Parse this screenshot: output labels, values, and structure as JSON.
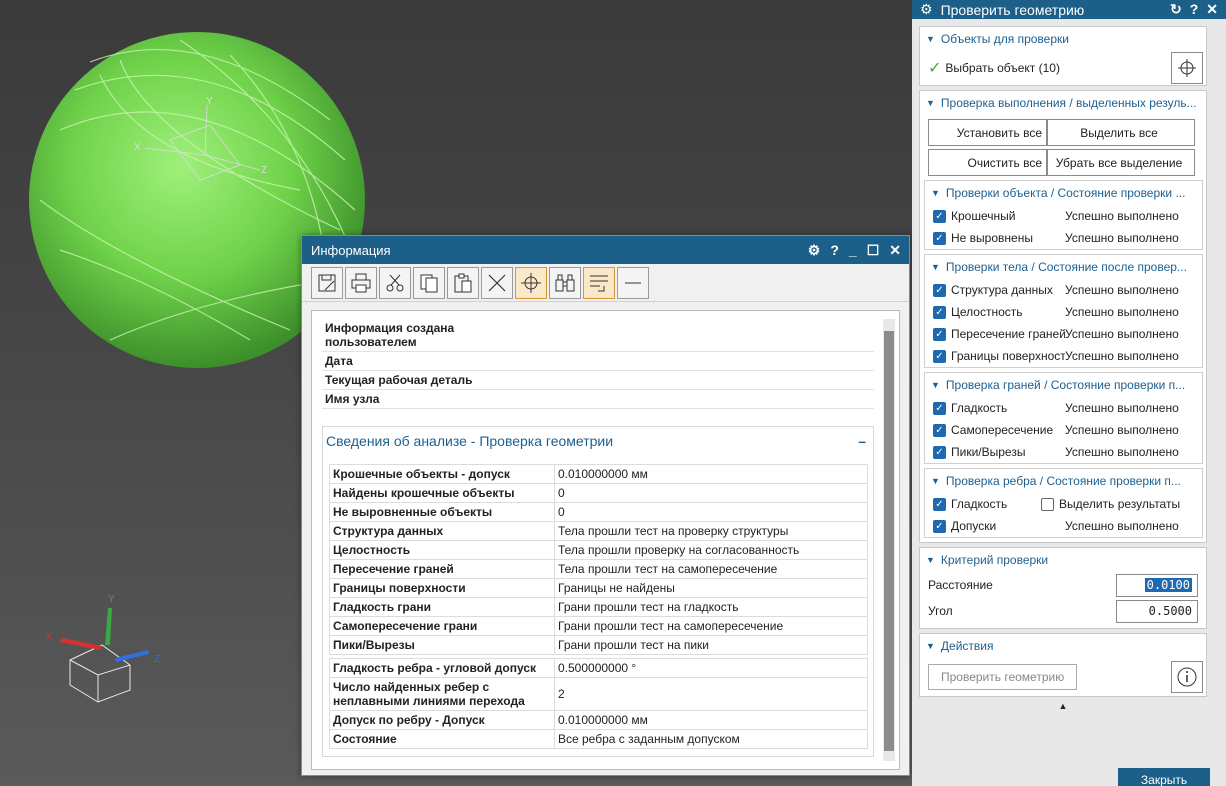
{
  "viewport": {
    "axis_x": "X",
    "axis_y": "Y",
    "axis_z": "Z"
  },
  "info": {
    "title": "Информация",
    "toolbar_icons": [
      "save-icon",
      "print-icon",
      "cut-icon",
      "copy-icon",
      "paste-icon",
      "delete-icon",
      "target-icon",
      "binoculars-icon",
      "wrap-icon",
      "minus-icon"
    ],
    "meta": [
      {
        "key": "Информация создана пользователем",
        "value": ""
      },
      {
        "key": "Дата",
        "value": ""
      },
      {
        "key": "Текущая рабочая деталь",
        "value": ""
      },
      {
        "key": "Имя узла",
        "value": ""
      }
    ],
    "section_title": "Сведения об анализе - Проверка геометрии",
    "section_collapse": "–",
    "rows1": [
      {
        "k": "Крошечные объекты - допуск",
        "v": "0.010000000 мм"
      },
      {
        "k": "Найдены крошечные объекты",
        "v": "0"
      },
      {
        "k": "Не выровненные объекты",
        "v": "0"
      },
      {
        "k": "Структура данных",
        "v": "Тела прошли тест на проверку структуры"
      },
      {
        "k": "Целостность",
        "v": "Тела прошли проверку на согласованность"
      },
      {
        "k": "Пересечение граней",
        "v": "Тела прошли тест на самопересечение"
      },
      {
        "k": "Границы поверхности",
        "v": "Границы не найдены"
      },
      {
        "k": "Гладкость грани",
        "v": "Грани прошли тест на гладкость"
      },
      {
        "k": "Самопересечение грани",
        "v": "Грани прошли тест на самопересечение"
      },
      {
        "k": "Пики/Вырезы",
        "v": "Грани прошли тест на пики"
      }
    ],
    "rows2": [
      {
        "k": "Гладкость ребра - угловой допуск",
        "v": "0.500000000 °"
      },
      {
        "k": "Число найденных ребер с неплавными линиями перехода",
        "v": "2"
      },
      {
        "k": "Допуск по ребру - Допуск",
        "v": "0.010000000 мм"
      },
      {
        "k": "Состояние",
        "v": "Все ребра с заданным допуском"
      }
    ]
  },
  "panel": {
    "title": "Проверить геометрию",
    "objects_header": "Объекты для проверки",
    "select_label": "Выбрать объект (10)",
    "run_header": "Проверка выполнения / выделенных резуль...",
    "buttons": [
      "Установить все",
      "Выделить все",
      "Очистить все",
      "Убрать все выделение"
    ],
    "object_checks": {
      "header": "Проверки объекта / Состояние проверки ...",
      "items": [
        {
          "label": "Крошечный",
          "status": "Успешно выполнено"
        },
        {
          "label": "Не выровнены",
          "status": "Успешно выполнено"
        }
      ]
    },
    "body_checks": {
      "header": "Проверки тела / Состояние после провер...",
      "items": [
        {
          "label": "Структура данных",
          "status": "Успешно выполнено"
        },
        {
          "label": "Целостность",
          "status": "Успешно выполнено"
        },
        {
          "label": "Пересечение граней",
          "status": "Успешно выполнено"
        },
        {
          "label": "Границы поверхности",
          "status": "Успешно выполнено"
        }
      ]
    },
    "face_checks": {
      "header": "Проверка граней / Состояние проверки п...",
      "items": [
        {
          "label": "Гладкость",
          "status": "Успешно выполнено"
        },
        {
          "label": "Самопересечение",
          "status": "Успешно выполнено"
        },
        {
          "label": "Пики/Вырезы",
          "status": "Успешно выполнено"
        }
      ]
    },
    "edge_checks": {
      "header": "Проверка ребра / Состояние проверки п...",
      "items": [
        {
          "label": "Гладкость",
          "status": ""
        },
        {
          "label": "Допуски",
          "status": "Успешно выполнено"
        }
      ],
      "highlight_label": "Выделить результаты"
    },
    "criteria_header": "Критерий проверки",
    "distance_label": "Расстояние",
    "distance_value": "0.0100",
    "angle_label": "Угол",
    "angle_value": "0.5000",
    "actions_header": "Действия",
    "check_button": "Проверить геометрию",
    "close_button": "Закрыть"
  }
}
